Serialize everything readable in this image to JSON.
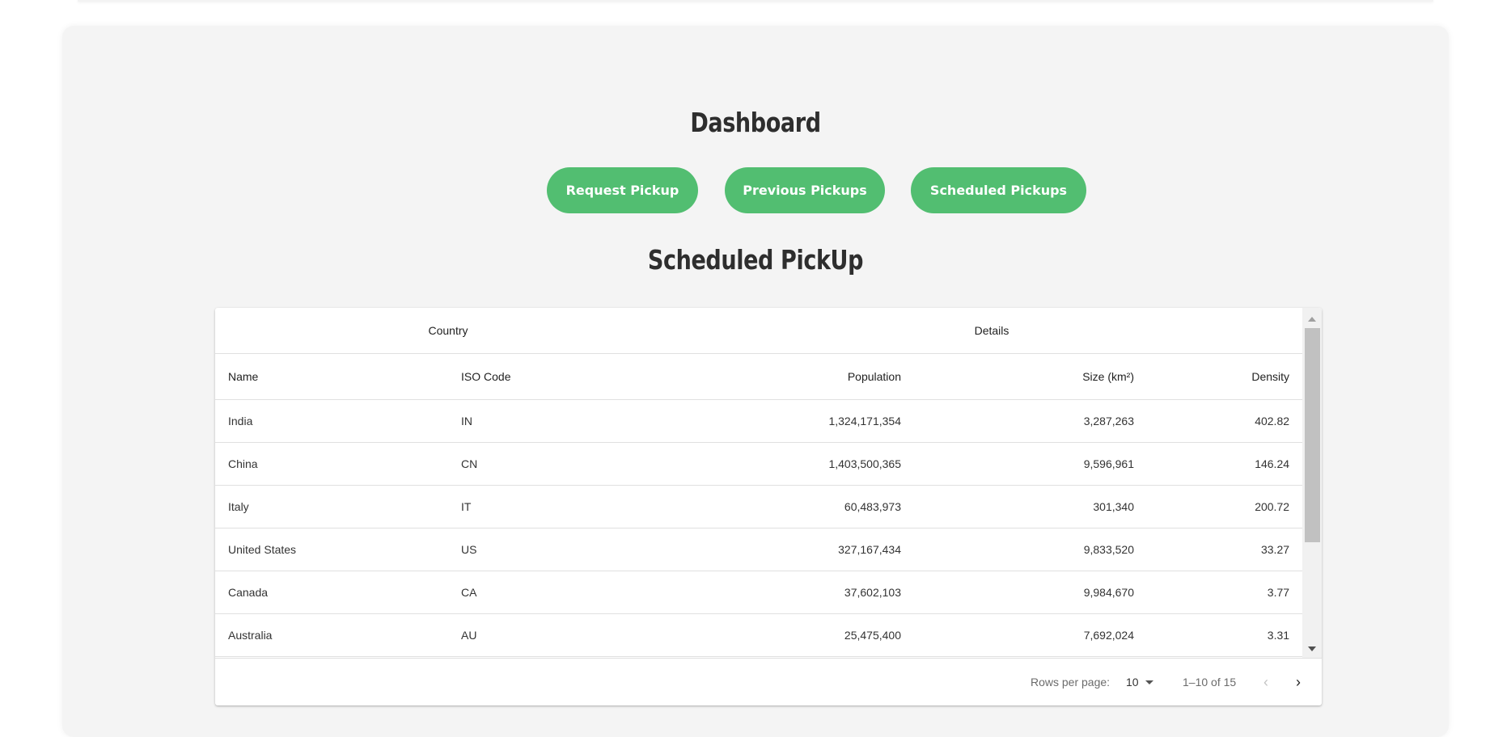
{
  "dashboard": {
    "title": "Dashboard",
    "buttons": {
      "request": "Request Pickup",
      "previous": "Previous Pickups",
      "scheduled": "Scheduled Pickups"
    },
    "section_title": "Scheduled PickUp"
  },
  "colors": {
    "accent": "#52be71",
    "panel_bg": "#f4f4f4"
  },
  "table": {
    "group_headers": [
      "Country",
      "Details"
    ],
    "columns": [
      "Name",
      "ISO Code",
      "Population",
      "Size (km²)",
      "Density"
    ],
    "rows": [
      [
        "India",
        "IN",
        "1,324,171,354",
        "3,287,263",
        "402.82"
      ],
      [
        "China",
        "CN",
        "1,403,500,365",
        "9,596,961",
        "146.24"
      ],
      [
        "Italy",
        "IT",
        "60,483,973",
        "301,340",
        "200.72"
      ],
      [
        "United States",
        "US",
        "327,167,434",
        "9,833,520",
        "33.27"
      ],
      [
        "Canada",
        "CA",
        "37,602,103",
        "9,984,670",
        "3.77"
      ],
      [
        "Australia",
        "AU",
        "25,475,400",
        "7,692,024",
        "3.31"
      ]
    ]
  },
  "pagination": {
    "rows_per_page_label": "Rows per page:",
    "rows_per_page": "10",
    "range": "1–10 of 15",
    "prev_icon": "chevron-left-icon",
    "next_icon": "chevron-right-icon"
  }
}
